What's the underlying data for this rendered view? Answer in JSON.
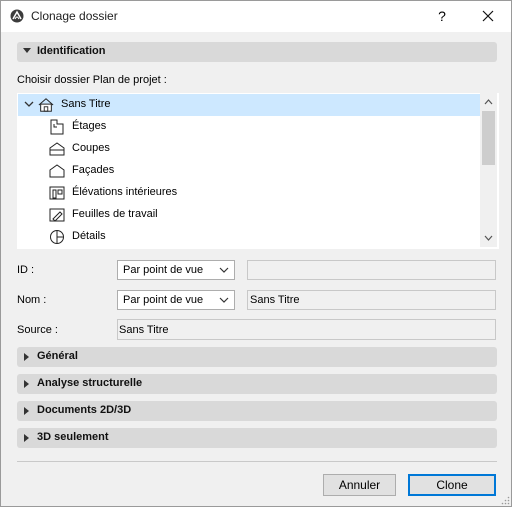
{
  "window": {
    "title": "Clonage dossier",
    "help_label": "?"
  },
  "identification": {
    "header": "Identification",
    "caption": "Choisir dossier Plan de projet :",
    "tree": {
      "root": "Sans Titre",
      "items": [
        "Étages",
        "Coupes",
        "Façades",
        "Élévations intérieures",
        "Feuilles de travail",
        "Détails"
      ]
    }
  },
  "fields": {
    "id": {
      "label": "ID :",
      "select": "Par point de vue",
      "value": ""
    },
    "nom": {
      "label": "Nom :",
      "select": "Par point de vue",
      "value": "Sans Titre"
    },
    "source": {
      "label": "Source :",
      "value": "Sans Titre"
    }
  },
  "sections": [
    "Général",
    "Analyse structurelle",
    "Documents 2D/3D",
    "3D seulement"
  ],
  "buttons": {
    "cancel": "Annuler",
    "clone": "Clone"
  }
}
